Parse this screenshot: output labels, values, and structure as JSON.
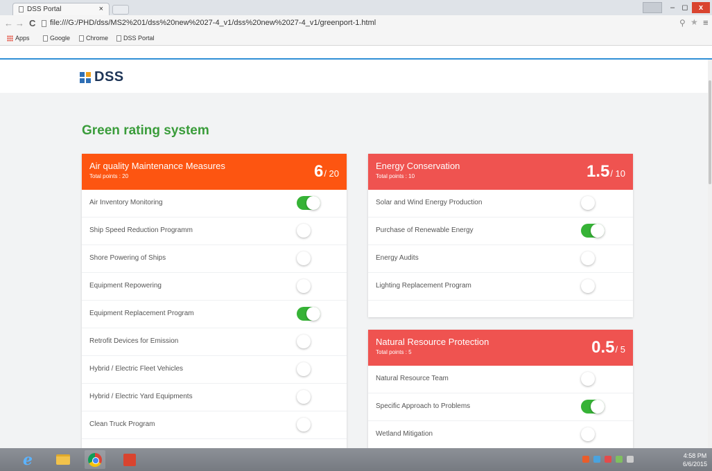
{
  "browser": {
    "tab_title": "DSS Portal",
    "tab_close": "×",
    "user_button": "",
    "minimize": "–",
    "maximize": "◻",
    "close": "x",
    "url": "file:///G:/PHD/dss/MS2%201/dss%20new%2027-4_v1/dss%20new%2027-4_v1/greenport-1.html",
    "bookmarks": [
      "Apps",
      "Google",
      "Chrome",
      "DSS Portal"
    ]
  },
  "header": {
    "logo_text": "DSS"
  },
  "page": {
    "title": "Green rating system"
  },
  "cards": [
    {
      "id": "air",
      "title": "Air quality Maintenance Measures",
      "subtitle": "Total points : 20",
      "score": "6",
      "max": "/ 20",
      "color": "#fd5511",
      "items": [
        {
          "label": "Air Inventory Monitoring",
          "on": true
        },
        {
          "label": "Ship Speed Reduction Programm",
          "on": false
        },
        {
          "label": "Shore Powering of Ships",
          "on": false
        },
        {
          "label": "Equipment Repowering",
          "on": false
        },
        {
          "label": "Equipment Replacement Program",
          "on": true
        },
        {
          "label": "Retrofit Devices for Emission",
          "on": false
        },
        {
          "label": "Hybrid / Electric Fleet Vehicles",
          "on": false
        },
        {
          "label": "Hybrid / Electric Yard Equipments",
          "on": false
        },
        {
          "label": "Clean Truck Program",
          "on": false
        }
      ]
    },
    {
      "id": "energy",
      "title": "Energy Conservation",
      "subtitle": "Total points : 10",
      "score": "1.5",
      "max": "/ 10",
      "color": "#ef5350",
      "items": [
        {
          "label": "Solar and Wind Energy Production",
          "on": false
        },
        {
          "label": "Purchase of Renewable Energy",
          "on": true
        },
        {
          "label": "Energy Audits",
          "on": false
        },
        {
          "label": "Lighting Replacement Program",
          "on": false
        }
      ]
    },
    {
      "id": "natural",
      "title": "Natural Resource Protection",
      "subtitle": "Total points : 5",
      "score": "0.5",
      "max": "/ 5",
      "color": "#ef5350",
      "items": [
        {
          "label": "Natural Resource Team",
          "on": false
        },
        {
          "label": "Specific Approach to Problems",
          "on": true
        },
        {
          "label": "Wetland Mitigation",
          "on": false
        }
      ]
    }
  ],
  "taskbar": {
    "apps": [
      "internet-explorer-icon",
      "file-explorer-icon",
      "chrome-icon",
      "app-icon"
    ],
    "clock_time": "4:58 PM",
    "clock_date": "6/6/2015",
    "tray_colors": [
      "#e95d2b",
      "#4aa3df",
      "#e34b4b",
      "#7fbf5f",
      "#cccccc"
    ]
  }
}
